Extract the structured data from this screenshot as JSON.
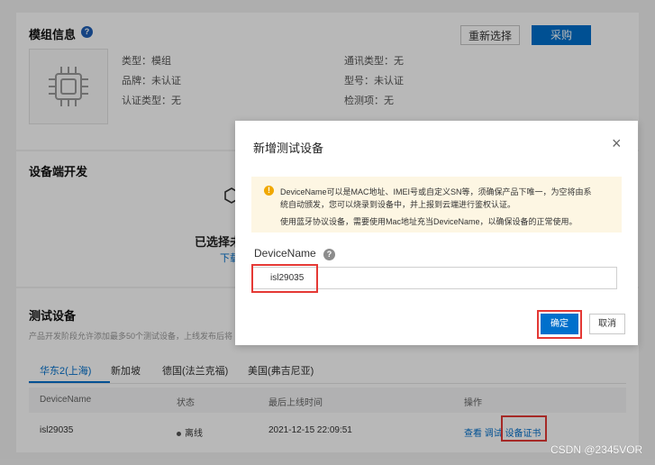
{
  "module": {
    "title": "模组信息",
    "help": "?",
    "reselect_label": "重新选择",
    "buy_label": "采购",
    "props": {
      "type": "类型：模组",
      "brand": "品牌：未认证",
      "cert_type": "认证类型：无",
      "comm_type": "通讯类型：无",
      "model": "型号：未认证",
      "test_item": "检测项：无"
    }
  },
  "device_dev": {
    "title": "设备端开发",
    "selected_text_partial": "已选择未",
    "download_partial": "下载"
  },
  "test_devices": {
    "title": "测试设备",
    "description": "产品开发阶段允许添加最多50个测试设备，上线发布后将",
    "tabs": [
      {
        "label": "华东2(上海)"
      },
      {
        "label": "新加坡"
      },
      {
        "label": "德国(法兰克福)"
      },
      {
        "label": "美国(弗吉尼亚)"
      }
    ],
    "columns": [
      "DeviceName",
      "状态",
      "最后上线时间",
      "操作"
    ],
    "rows": [
      {
        "device_name": "isl29035",
        "status": "离线",
        "last_online": "2021-12-15 22:09:51",
        "actions": {
          "view": "查看",
          "debug": "调试",
          "cert": "设备证书"
        }
      }
    ]
  },
  "modal": {
    "title": "新增测试设备",
    "close": "×",
    "notice_icon": "!",
    "notice_lines": [
      "DeviceName可以是MAC地址、IMEI号或自定义SN等，须确保产品下唯一，为空将由系",
      "统自动颁发，您可以烧录到设备中，并上报到云端进行鉴权认证。",
      "使用蓝牙协议设备，需要使用Mac地址充当DeviceName，以确保设备的正常使用。"
    ],
    "field_label": "DeviceName",
    "field_help": "?",
    "field_value": "isl29035",
    "ok_label": "确定",
    "cancel_label": "取消"
  },
  "watermark": "CSDN @2345VOR",
  "colors": {
    "primary": "#0070cc",
    "highlight": "#e53935",
    "notice_bg": "#fdf6e3",
    "warning": "#f0a800"
  },
  "icons": [
    "chip-icon",
    "help-icon",
    "close-icon",
    "warning-icon",
    "hexagon-icon"
  ]
}
